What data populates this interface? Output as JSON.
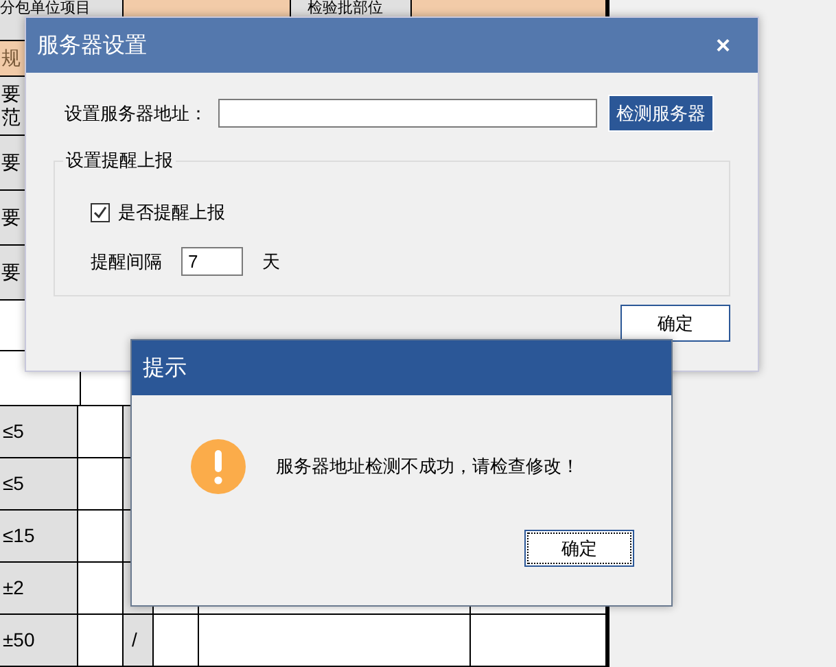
{
  "sheet": {
    "top_row": [
      {
        "kind": "label",
        "text": "分包单位项目"
      },
      {
        "kind": "fill"
      },
      {
        "kind": "label",
        "text": "检验批部位"
      },
      {
        "kind": "fill"
      }
    ],
    "side_rows": [
      {
        "kind": "accent",
        "lines": [
          "规"
        ]
      },
      {
        "kind": "label",
        "lines": [
          "要",
          "范"
        ]
      },
      {
        "kind": "label",
        "lines": [
          "要"
        ]
      },
      {
        "kind": "label",
        "lines": [
          "要"
        ]
      },
      {
        "kind": "label",
        "lines": [
          "要"
        ]
      },
      {
        "kind": "blank"
      },
      {
        "kind": "blank"
      }
    ],
    "value_rows": [
      {
        "limit": "≤5"
      },
      {
        "limit": "≤5"
      },
      {
        "limit": "≤15"
      },
      {
        "limit": "±2"
      },
      {
        "limit": "±50",
        "column_3": "/"
      }
    ]
  },
  "settings_dialog": {
    "title": "服务器设置",
    "close": "×",
    "address_label": "设置服务器地址：",
    "check_button": "检测服务器",
    "group_title": "设置提醒上报",
    "remind_checkbox": {
      "label": "是否提醒上报",
      "checked": true
    },
    "interval_label": "提醒间隔",
    "interval_value": "7",
    "interval_unit": "天",
    "ok_button": "确定"
  },
  "message_dialog": {
    "title": "提示",
    "message": "服务器地址检测不成功，请检查修改！",
    "ok_button": "确定"
  }
}
